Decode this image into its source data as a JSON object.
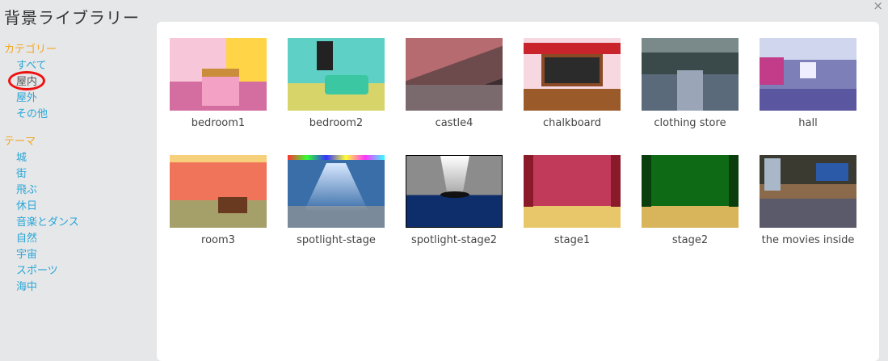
{
  "header": {
    "title": "背景ライブラリー",
    "close_glyph": "×"
  },
  "sidebar": {
    "category_heading": "カテゴリー",
    "categories": [
      {
        "label": "すべて",
        "selected": false
      },
      {
        "label": "屋内",
        "selected": true
      },
      {
        "label": "屋外",
        "selected": false
      },
      {
        "label": "その他",
        "selected": false
      }
    ],
    "theme_heading": "テーマ",
    "themes": [
      {
        "label": "城"
      },
      {
        "label": "街"
      },
      {
        "label": "飛ぶ"
      },
      {
        "label": "休日"
      },
      {
        "label": "音楽とダンス"
      },
      {
        "label": "自然"
      },
      {
        "label": "宇宙"
      },
      {
        "label": "スポーツ"
      },
      {
        "label": "海中"
      }
    ]
  },
  "library": {
    "items": [
      {
        "label": "bedroom1"
      },
      {
        "label": "bedroom2"
      },
      {
        "label": "castle4"
      },
      {
        "label": "chalkboard"
      },
      {
        "label": "clothing store"
      },
      {
        "label": "hall"
      },
      {
        "label": "room3"
      },
      {
        "label": "spotlight-stage"
      },
      {
        "label": "spotlight-stage2"
      },
      {
        "label": "stage1"
      },
      {
        "label": "stage2"
      },
      {
        "label": "the movies inside"
      }
    ]
  },
  "colors": {
    "category_heading": "#f5a623",
    "link": "#29a6d8",
    "selection_ring": "#ee1111",
    "panel_bg": "#ffffff",
    "page_bg": "#e6e7e8"
  }
}
